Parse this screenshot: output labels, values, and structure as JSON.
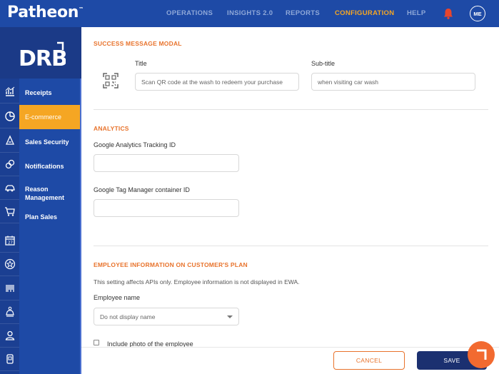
{
  "brand": {
    "name": "Patheon",
    "tm": "™"
  },
  "nav": [
    {
      "label": "OPERATIONS"
    },
    {
      "label": "INSIGHTS 2.0"
    },
    {
      "label": "REPORTS"
    },
    {
      "label": "CONFIGURATION"
    },
    {
      "label": "HELP"
    }
  ],
  "user": {
    "initials": "ME"
  },
  "logo": {
    "text": "DRB"
  },
  "sidebar": {
    "items": [
      {
        "label": "Receipts",
        "icon": "chart-icon"
      },
      {
        "label": "E-commerce",
        "icon": "pie-chart-icon",
        "active": true
      },
      {
        "label": "Sales Security",
        "icon": "shield-icon"
      },
      {
        "label": "Notifications",
        "icon": "link-icon"
      },
      {
        "label": "Reason Management",
        "icon": "car-icon"
      },
      {
        "label": "Plan Sales",
        "icon": "cart-icon"
      }
    ],
    "extra_icons": [
      "calendar-icon",
      "star-icon",
      "barcode-icon",
      "car-wash-icon",
      "user-icon",
      "device-icon"
    ]
  },
  "modal_section": {
    "title": "SUCCESS MESSAGE MODAL",
    "title_label": "Title",
    "title_value": "Scan QR code at the wash to redeem your purchase",
    "subtitle_label": "Sub-title",
    "subtitle_value": "when visiting car wash"
  },
  "analytics": {
    "title": "ANALYTICS",
    "ga_label": "Google Analytics Tracking ID",
    "ga_value": "",
    "gtm_label": "Google Tag Manager container ID",
    "gtm_value": ""
  },
  "employee": {
    "title": "EMPLOYEE INFORMATION ON CUSTOMER'S PLAN",
    "note": "This setting affects APIs only. Employee information is not displayed in EWA.",
    "name_label": "Employee name",
    "name_selected": "Do not display name",
    "photo_label": "Include photo of the employee",
    "photo_checked": false
  },
  "footer": {
    "cancel_label": "CANCEL",
    "save_label": "SAVE"
  },
  "colors": {
    "primary": "#1e4aa6",
    "accent": "#f5a623",
    "orange": "#e8732c",
    "save": "#1b3070"
  }
}
